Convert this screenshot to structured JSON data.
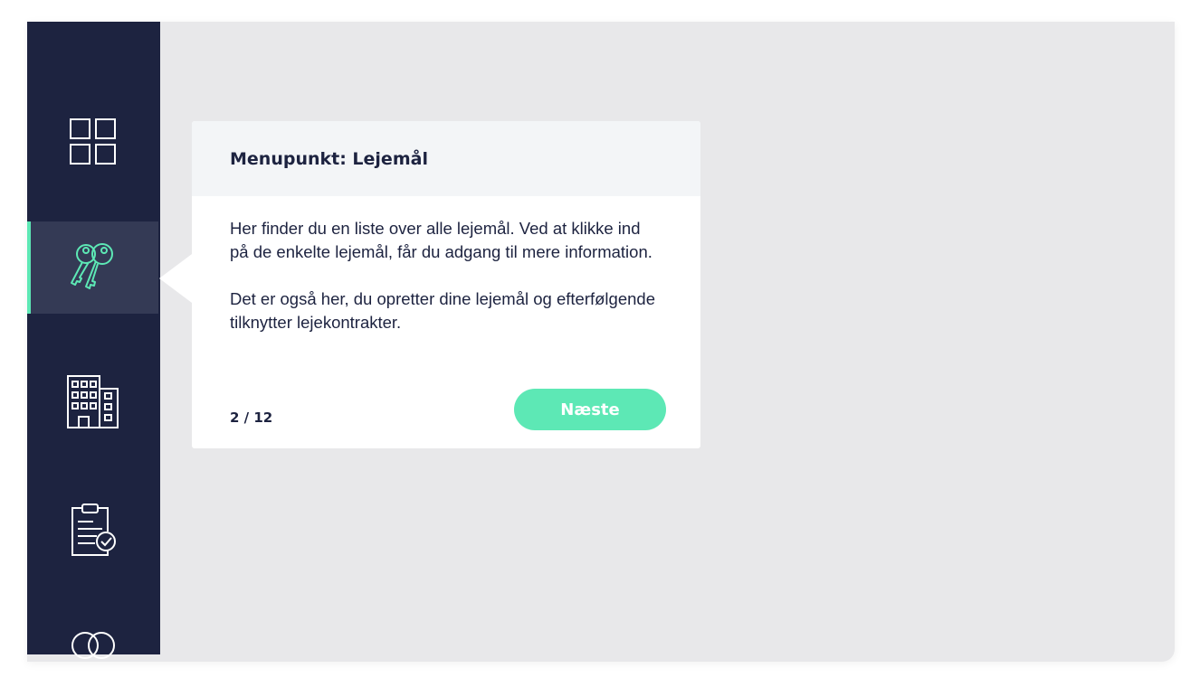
{
  "sidebar": {
    "items": [
      {
        "name": "dashboard",
        "icon": "dashboard-grid-icon"
      },
      {
        "name": "lejemaal",
        "icon": "keys-icon",
        "active": true
      },
      {
        "name": "properties",
        "icon": "building-icon"
      },
      {
        "name": "tasks",
        "icon": "clipboard-check-icon"
      },
      {
        "name": "more",
        "icon": "circles-icon"
      }
    ]
  },
  "tooltip": {
    "title": "Menupunkt: Lejemål",
    "paragraph1": "Her finder du en liste over alle lejemål. Ved at klikke ind på de enkelte lejemål, får du adgang til mere information.",
    "paragraph2": "Det er også her, du opretter dine lejemål og efterfølgende tilknytter lejekontrakter.",
    "step": "2 / 12",
    "next_label": "Næste"
  },
  "colors": {
    "sidebar_bg": "#1d2340",
    "active_item_bg": "#343a55",
    "accent": "#5de8b5",
    "content_bg": "#e8e8ea"
  }
}
